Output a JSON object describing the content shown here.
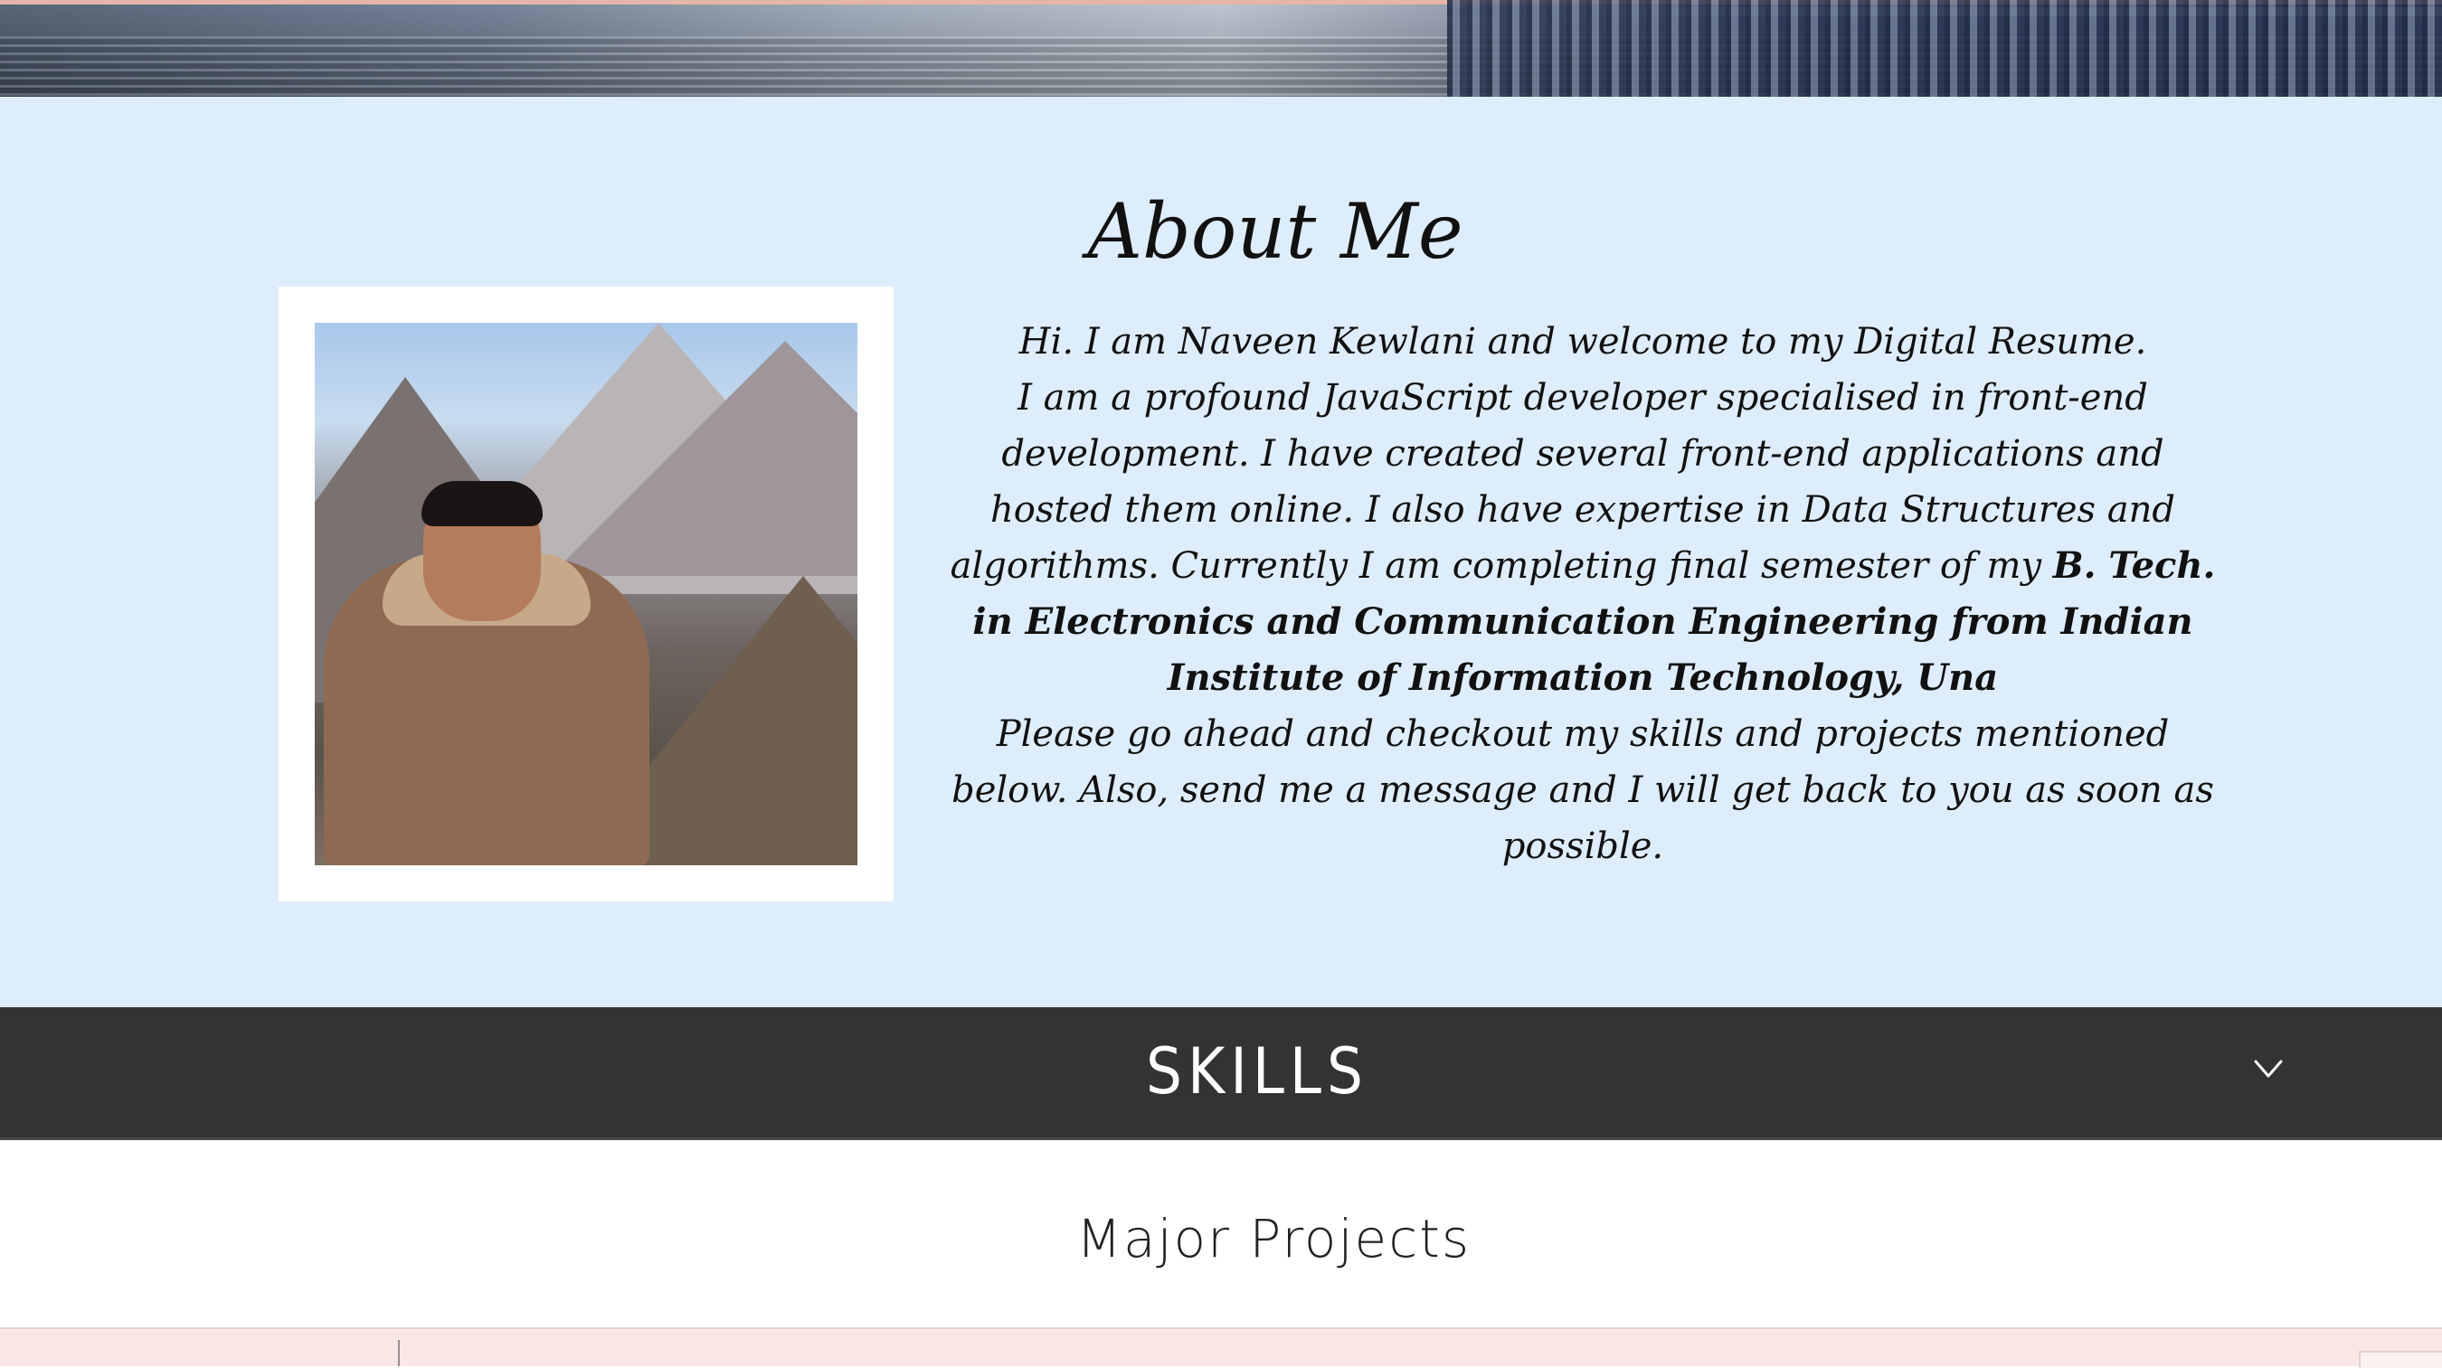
{
  "hero": {
    "image_description": "hero-banner-image"
  },
  "about": {
    "title": "About Me",
    "photo_alt": "portrait-photo",
    "intro": "Hi. I am Naveen Kewlani and welcome to my Digital Resume.",
    "body_part1": "I am a profound JavaScript developer specialised in front-end development. I have created several front-end applications and hosted them online. I also have expertise in Data Structures and algorithms. Currently I am completing final semester of my ",
    "body_bold": "B. Tech. in Electronics and Communication Engineering from Indian Institute of Information Technology, Una",
    "closing": "Please go ahead and checkout my skills and projects mentioned below. Also, send me a message and I will get back to you as soon as possible."
  },
  "skills": {
    "title": "SKILLS",
    "toggle_icon": "chevron-down-icon"
  },
  "projects": {
    "title": "Major Projects"
  },
  "colors": {
    "about_bg": "#deedfb",
    "skills_bg": "#333333",
    "projects_strip_bg": "#f8e7e5"
  }
}
